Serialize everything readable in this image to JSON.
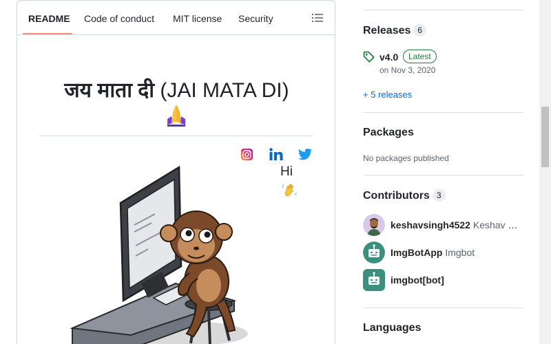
{
  "tabs": [
    {
      "label": "README",
      "active": true
    },
    {
      "label": "Code of conduct"
    },
    {
      "label": "MIT license"
    },
    {
      "label": "Security"
    }
  ],
  "icons": {
    "outline": "list-unordered-icon",
    "pray": "folded-hands-emoji-icon",
    "instagram": "instagram-icon",
    "linkedin": "linkedin-icon",
    "twitter": "twitter-icon",
    "wave": "waving-hand-emoji-icon",
    "tag": "tag-icon"
  },
  "readme": {
    "title_devanagari": "जय माता दी",
    "title_latin": "(JAI MATA DI)",
    "greeting": "Hi"
  },
  "sidebar": {
    "releases": {
      "heading": "Releases",
      "count": "6",
      "latest_tag": "v4.0",
      "latest_badge": "Latest",
      "latest_date": "on Nov 3, 2020",
      "more_link": "+ 5 releases"
    },
    "packages": {
      "heading": "Packages",
      "empty_text": "No packages published"
    },
    "contributors": {
      "heading": "Contributors",
      "count": "3",
      "items": [
        {
          "login": "keshavsingh4522",
          "name": "Keshav Singh"
        },
        {
          "login": "ImgBotApp",
          "name": "Imgbot"
        },
        {
          "login": "imgbot[bot]",
          "name": ""
        }
      ]
    },
    "languages": {
      "heading": "Languages"
    }
  },
  "colors": {
    "accent_link": "#0969da",
    "tab_underline": "#fd8c73",
    "latest_green": "#1a7f37",
    "bot_teal": "#3a8f7f",
    "border": "#d0d7de"
  }
}
